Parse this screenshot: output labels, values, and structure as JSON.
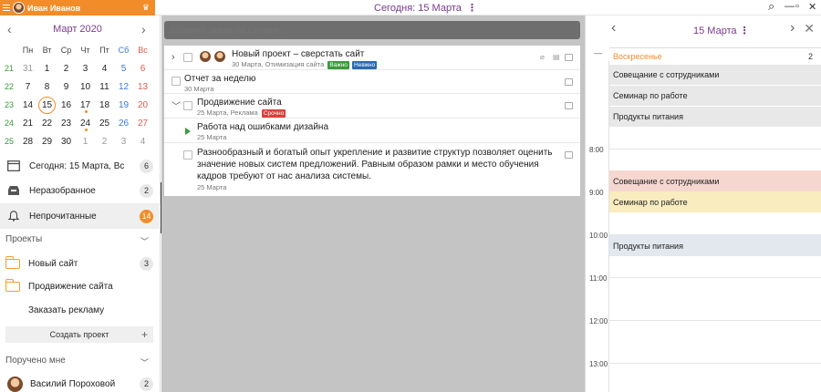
{
  "titlebar": {
    "user_name": "Иван Иванов",
    "today_label": "Сегодня: 15 Марта",
    "more_glyph": "⋮",
    "search_glyph": "⌕",
    "minimize_glyph": "—",
    "maximize_glyph": "▫",
    "close_glyph": "✕"
  },
  "calendar": {
    "month": "Март 2020",
    "prev": "‹",
    "next": "›",
    "weekday_headers": [
      "Пн",
      "Вт",
      "Ср",
      "Чт",
      "Пт",
      "Сб",
      "Вс"
    ],
    "weeks": [
      {
        "wk": "21",
        "days": [
          "31",
          "1",
          "2",
          "3",
          "4",
          "5",
          "6"
        ]
      },
      {
        "wk": "22",
        "days": [
          "7",
          "8",
          "9",
          "10",
          "11",
          "12",
          "13"
        ]
      },
      {
        "wk": "23",
        "days": [
          "14",
          "15",
          "16",
          "17",
          "18",
          "19",
          "20"
        ]
      },
      {
        "wk": "24",
        "days": [
          "21",
          "22",
          "23",
          "24",
          "25",
          "26",
          "27"
        ]
      },
      {
        "wk": "25",
        "days": [
          "28",
          "29",
          "30",
          "1",
          "2",
          "3",
          "4"
        ]
      }
    ]
  },
  "nav": {
    "today": {
      "label": "Сегодня: 15 Марта, Вс",
      "count": "6"
    },
    "inbox": {
      "label": "Неразобранное",
      "count": "2"
    },
    "unread": {
      "label": "Непрочитанные",
      "count": "14"
    }
  },
  "projects": {
    "title": "Проекты",
    "items": [
      {
        "label": "Новый сайт",
        "count": "3"
      },
      {
        "label": "Продвижение сайта"
      },
      {
        "label": "Заказать рекламу"
      }
    ],
    "create_label": "Создать проект",
    "create_plus": "+"
  },
  "assigned": {
    "title": "Поручено мне",
    "items": [
      {
        "label": "Василий Пороховой",
        "count": "2"
      }
    ]
  },
  "tasks": {
    "add_placeholder": "Добавить задачу на Сегодня ...",
    "items": [
      {
        "title": "Новый проект – сверстать сайт",
        "meta": "30 Марта, Отимизация сайта",
        "tags": [
          {
            "text": "Важно",
            "color": "#3a9a3a"
          },
          {
            "text": "Невжно",
            "color": "#2a6ab0"
          }
        ]
      },
      {
        "title": "Отчет за неделю",
        "meta": "30 Марта"
      },
      {
        "title": "Продвижение сайта",
        "meta": "25 Марта, Реклама",
        "tags": [
          {
            "text": "Срочно",
            "color": "#d9413a"
          }
        ]
      },
      {
        "title": "Работа над ошибками дизайна",
        "meta": "25 Марта"
      },
      {
        "title": "Разнообразный и богатый опыт укрепление и развитие структур позволяет оценить значение новых систем предложений. Равным образом рамки и место обучения кадров требуют от нас анализа системы.",
        "meta": "25 Марта"
      }
    ]
  },
  "dayview": {
    "date": "15 Марта",
    "more_glyph": "⋮",
    "prev": "‹",
    "next": "›",
    "close": "✕",
    "collapse_glyph": "—",
    "day_name": "Воскресенье",
    "day_count": "2",
    "allday_events": [
      "Совещание с сотрудниками",
      "Семинар по работе",
      "Продукты питания"
    ],
    "times": [
      "8:00",
      "9:00",
      "10:00",
      "11:00",
      "12:00",
      "13:00"
    ],
    "timed_events": [
      {
        "title": "Совещание с сотрудниками",
        "color": "#f6d7d0"
      },
      {
        "title": "Семинар по работе",
        "color": "#f9ecbf"
      },
      {
        "title": "Продукты питания",
        "color": "#e3e8ef"
      }
    ]
  },
  "colors": {
    "accent_orange": "#f28c28",
    "accent_purple": "#7a3a8c",
    "week_green": "#3a9a3a",
    "weekend_red": "#e05a4a",
    "saturday_blue": "#3a7ad9"
  }
}
